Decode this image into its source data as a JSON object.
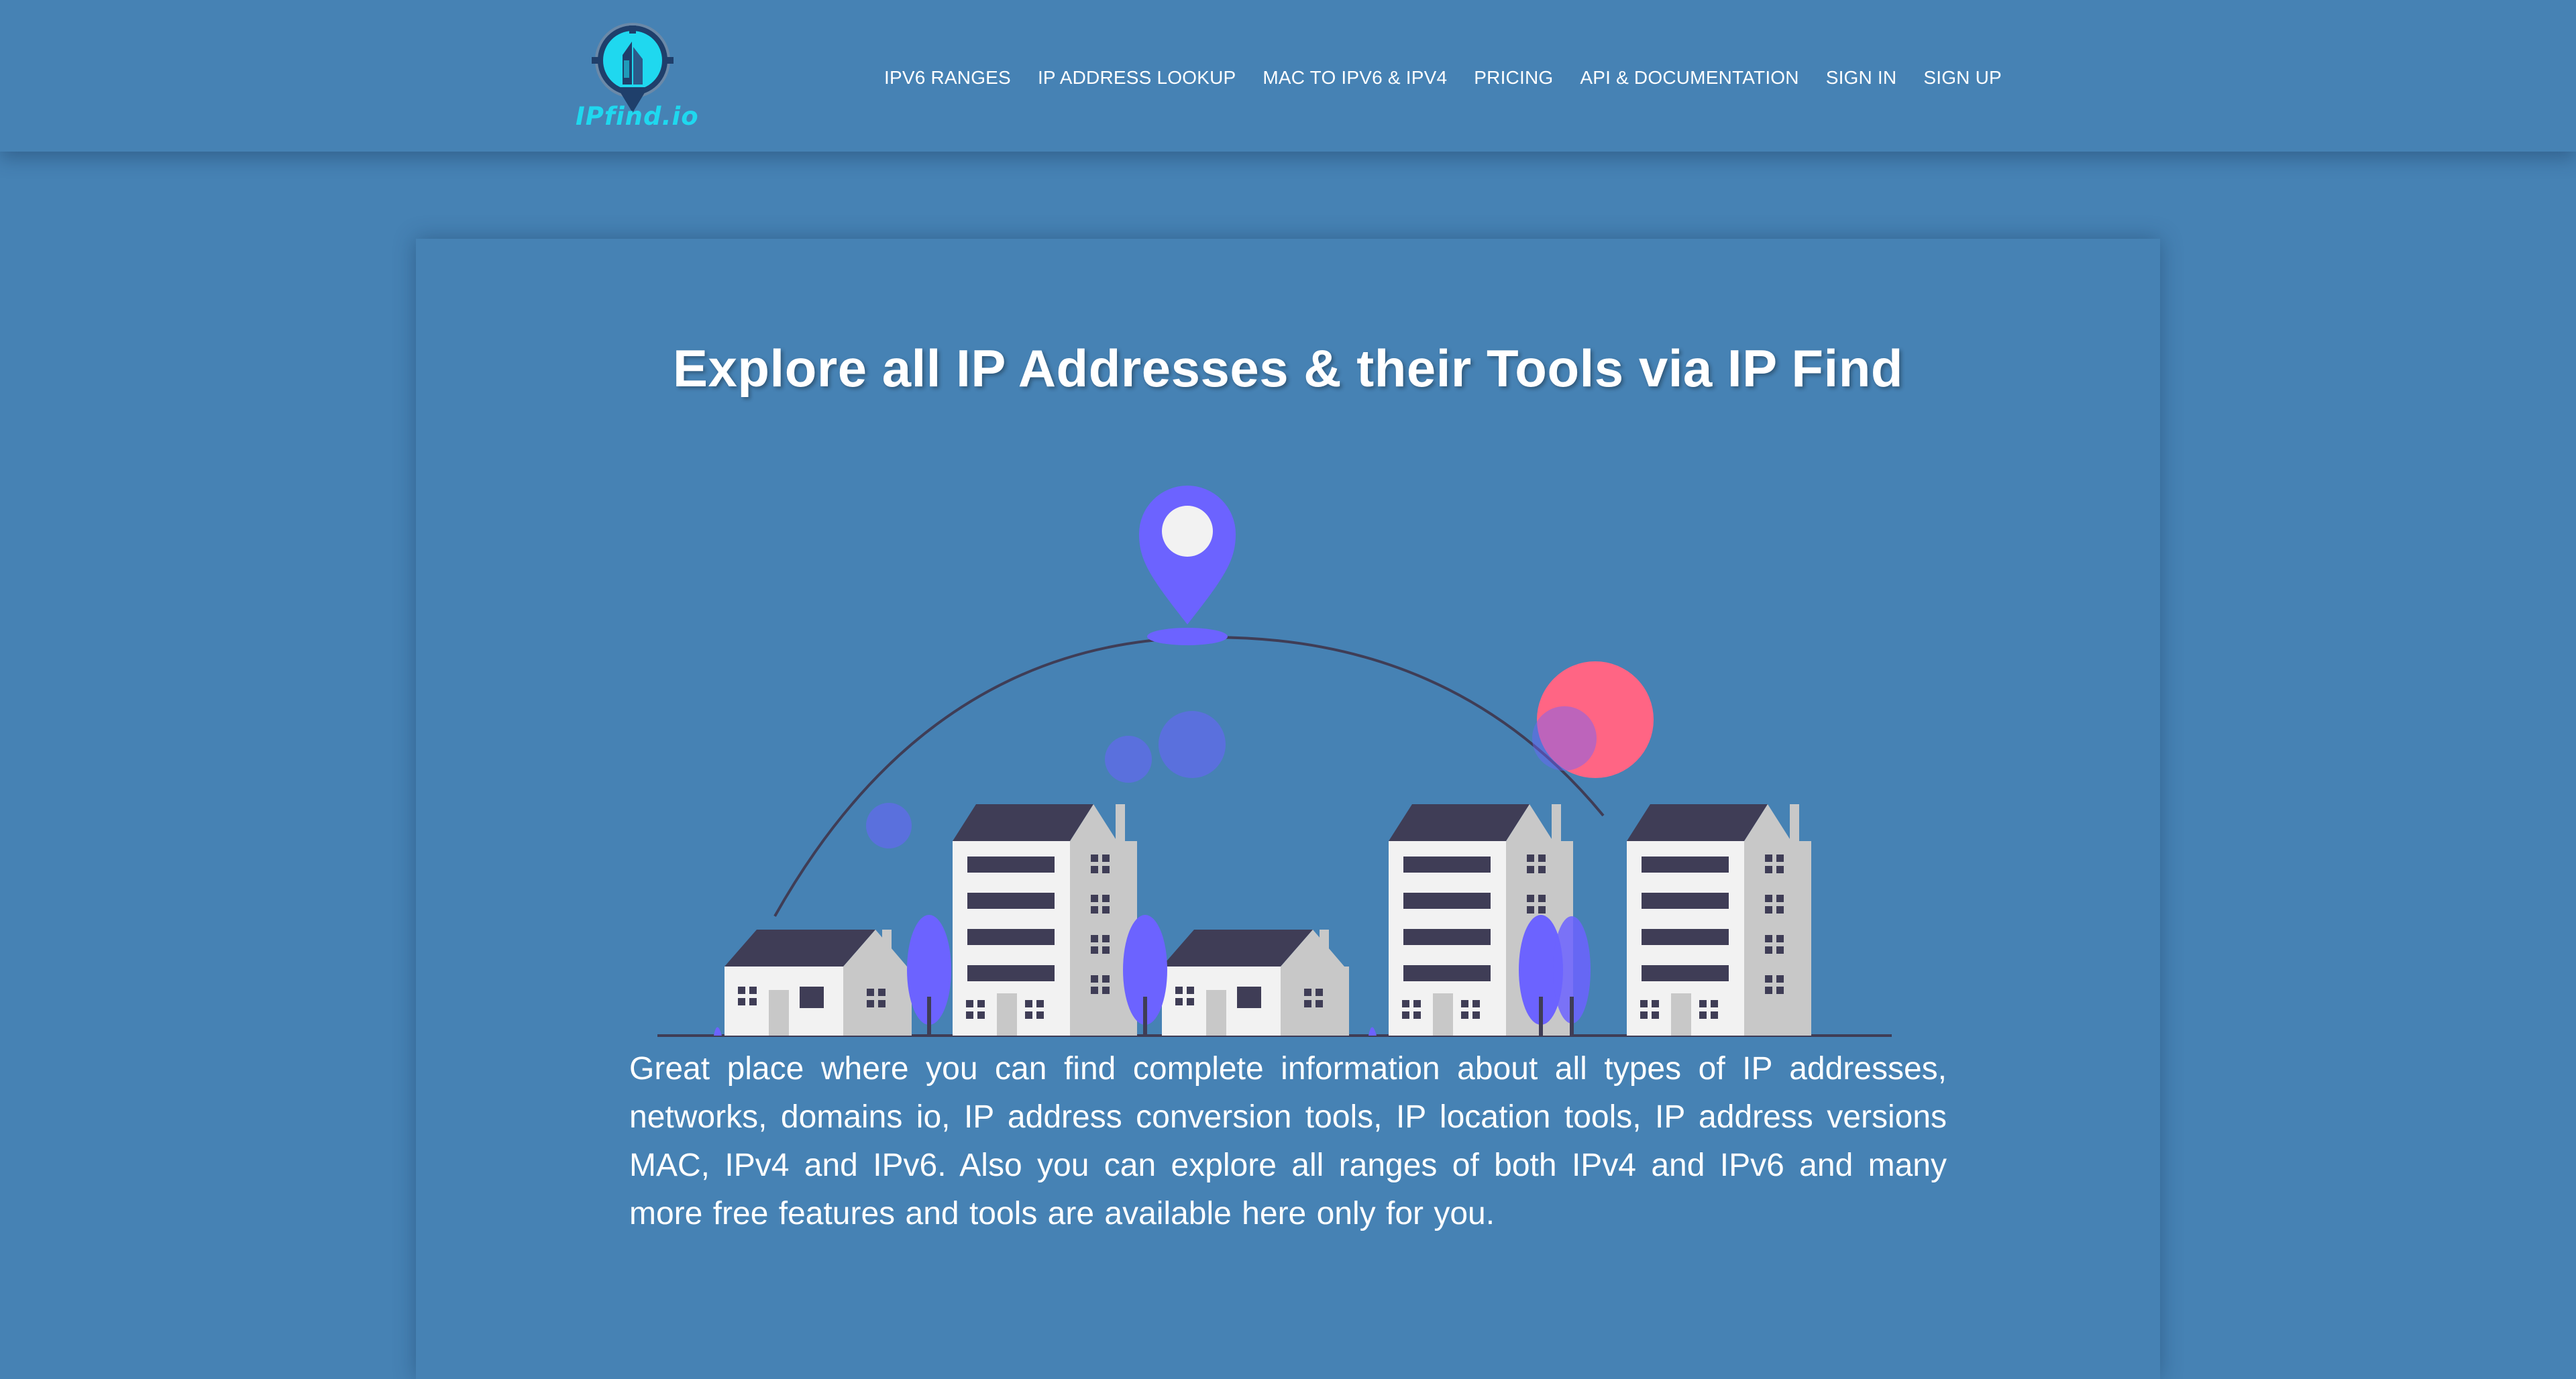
{
  "site": {
    "logo_text": "IPfind.io",
    "logo_icon": "map-pin-building-logo-icon"
  },
  "nav": {
    "items": [
      {
        "label": "IPV6 RANGES"
      },
      {
        "label": "IP ADDRESS LOOKUP"
      },
      {
        "label": "MAC TO IPV6 & IPV4"
      },
      {
        "label": "PRICING"
      },
      {
        "label": "API & DOCUMENTATION"
      },
      {
        "label": "SIGN IN"
      },
      {
        "label": "SIGN UP"
      }
    ]
  },
  "hero": {
    "title": "Explore all IP Addresses & their Tools via IP Find",
    "illustration_icon": "location-pin-city-illustration",
    "description": "Great place where you can find complete information about all types of IP addresses, networks, domains io, IP address conversion tools, IP location tools, IP address versions MAC, IPv4 and IPv6. Also you can explore all ranges of both IPv4 and IPv6 and many more free features and tools are available here only for you."
  },
  "colors": {
    "background": "#4682b4",
    "pin": "#6c63ff",
    "accent_circle": "#ff6584",
    "building_roof": "#3f3d56",
    "building_wall": "#f2f2f2",
    "building_side": "#cccccc",
    "logo_text": "#1fd8ef"
  }
}
